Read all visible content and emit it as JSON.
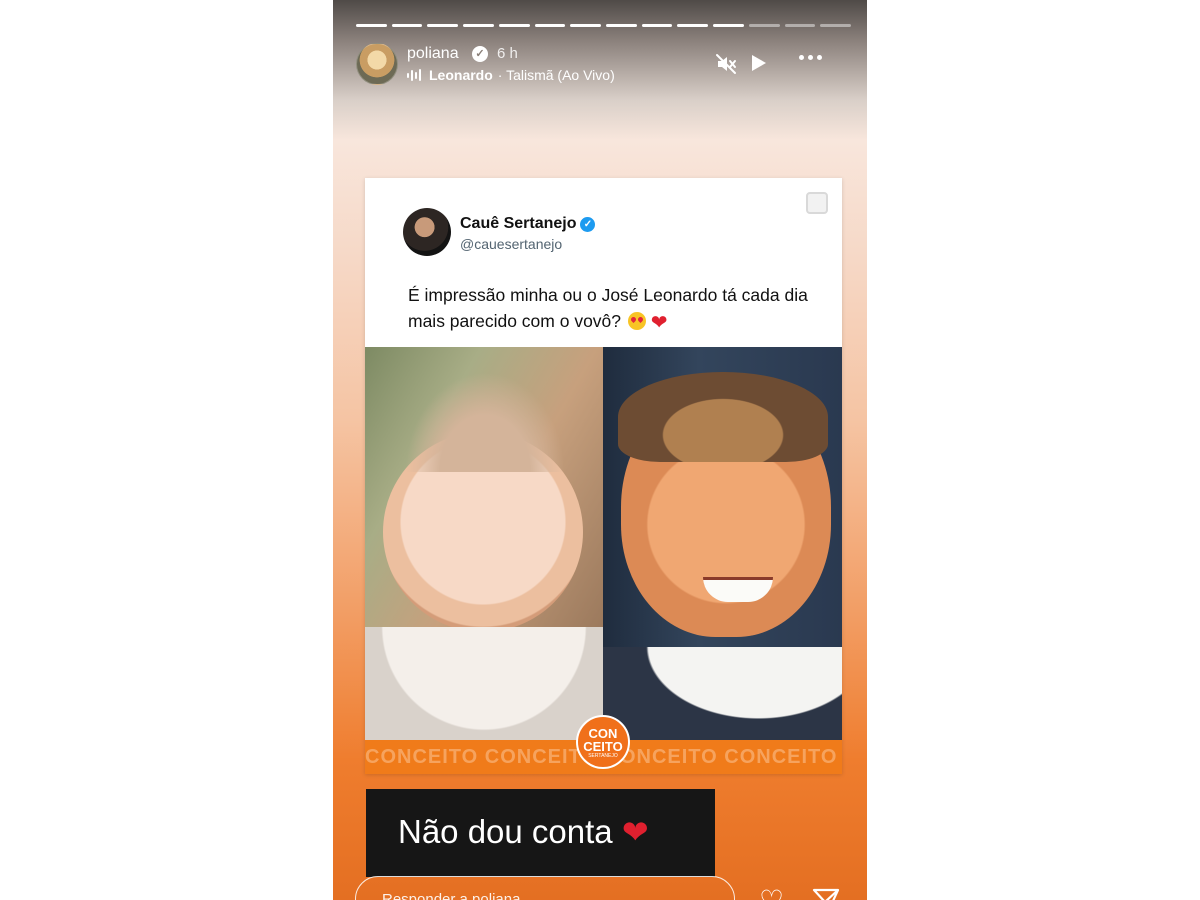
{
  "story": {
    "progress": {
      "total_segments": 14,
      "completed_segments": 11
    },
    "header": {
      "username": "poliana",
      "time": "6 h",
      "music_artist": "Leonardo",
      "music_track": "· Talismã (Ao Vivo)"
    },
    "tweet": {
      "name": "Cauê Sertanejo",
      "handle": "@cauesertanejo",
      "text": "É impressão minha ou o José Leonardo tá cada dia mais parecido com o vovô?"
    },
    "brand": {
      "logo_line1": "CON",
      "logo_line2": "CEITO",
      "logo_line3": "SERTANEJO",
      "strip_text": "CONCEITO CONCEITO CONCEITO CONCEITO CONCEITO CONCEITO"
    },
    "caption": {
      "text": "Não dou conta"
    },
    "footer": {
      "reply_placeholder": "Responder a poliana..."
    }
  }
}
